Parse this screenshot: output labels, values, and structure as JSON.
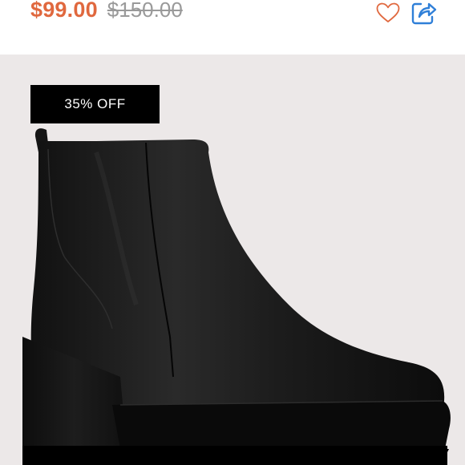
{
  "listing": {
    "price": "$99.00",
    "original_price": "$150.00",
    "discount_badge": "35% OFF"
  },
  "actions": {
    "like_icon": "heart-outline-icon",
    "share_icon": "share-arrow-icon"
  },
  "colors": {
    "price": "#e0683e",
    "accent": "#2f7fd8",
    "like_icon": "#e0683e",
    "image_background": "#ece8e8",
    "badge_background": "#000000",
    "badge_text": "#ffffff"
  }
}
